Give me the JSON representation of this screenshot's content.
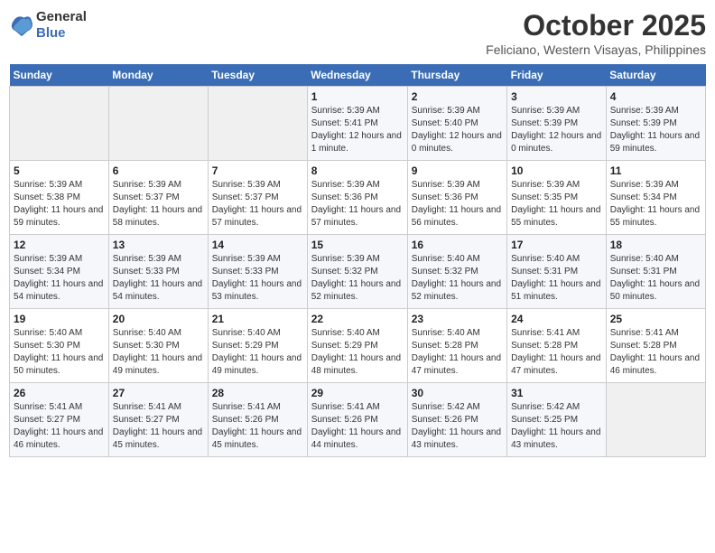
{
  "header": {
    "logo_general": "General",
    "logo_blue": "Blue",
    "month": "October 2025",
    "location": "Feliciano, Western Visayas, Philippines"
  },
  "weekdays": [
    "Sunday",
    "Monday",
    "Tuesday",
    "Wednesday",
    "Thursday",
    "Friday",
    "Saturday"
  ],
  "weeks": [
    [
      {
        "day": "",
        "empty": true
      },
      {
        "day": "",
        "empty": true
      },
      {
        "day": "",
        "empty": true
      },
      {
        "day": "1",
        "sunrise": "5:39 AM",
        "sunset": "5:41 PM",
        "daylight": "12 hours and 1 minute."
      },
      {
        "day": "2",
        "sunrise": "5:39 AM",
        "sunset": "5:40 PM",
        "daylight": "12 hours and 0 minutes."
      },
      {
        "day": "3",
        "sunrise": "5:39 AM",
        "sunset": "5:39 PM",
        "daylight": "12 hours and 0 minutes."
      },
      {
        "day": "4",
        "sunrise": "5:39 AM",
        "sunset": "5:39 PM",
        "daylight": "11 hours and 59 minutes."
      }
    ],
    [
      {
        "day": "5",
        "sunrise": "5:39 AM",
        "sunset": "5:38 PM",
        "daylight": "11 hours and 59 minutes."
      },
      {
        "day": "6",
        "sunrise": "5:39 AM",
        "sunset": "5:37 PM",
        "daylight": "11 hours and 58 minutes."
      },
      {
        "day": "7",
        "sunrise": "5:39 AM",
        "sunset": "5:37 PM",
        "daylight": "11 hours and 57 minutes."
      },
      {
        "day": "8",
        "sunrise": "5:39 AM",
        "sunset": "5:36 PM",
        "daylight": "11 hours and 57 minutes."
      },
      {
        "day": "9",
        "sunrise": "5:39 AM",
        "sunset": "5:36 PM",
        "daylight": "11 hours and 56 minutes."
      },
      {
        "day": "10",
        "sunrise": "5:39 AM",
        "sunset": "5:35 PM",
        "daylight": "11 hours and 55 minutes."
      },
      {
        "day": "11",
        "sunrise": "5:39 AM",
        "sunset": "5:34 PM",
        "daylight": "11 hours and 55 minutes."
      }
    ],
    [
      {
        "day": "12",
        "sunrise": "5:39 AM",
        "sunset": "5:34 PM",
        "daylight": "11 hours and 54 minutes."
      },
      {
        "day": "13",
        "sunrise": "5:39 AM",
        "sunset": "5:33 PM",
        "daylight": "11 hours and 54 minutes."
      },
      {
        "day": "14",
        "sunrise": "5:39 AM",
        "sunset": "5:33 PM",
        "daylight": "11 hours and 53 minutes."
      },
      {
        "day": "15",
        "sunrise": "5:39 AM",
        "sunset": "5:32 PM",
        "daylight": "11 hours and 52 minutes."
      },
      {
        "day": "16",
        "sunrise": "5:40 AM",
        "sunset": "5:32 PM",
        "daylight": "11 hours and 52 minutes."
      },
      {
        "day": "17",
        "sunrise": "5:40 AM",
        "sunset": "5:31 PM",
        "daylight": "11 hours and 51 minutes."
      },
      {
        "day": "18",
        "sunrise": "5:40 AM",
        "sunset": "5:31 PM",
        "daylight": "11 hours and 50 minutes."
      }
    ],
    [
      {
        "day": "19",
        "sunrise": "5:40 AM",
        "sunset": "5:30 PM",
        "daylight": "11 hours and 50 minutes."
      },
      {
        "day": "20",
        "sunrise": "5:40 AM",
        "sunset": "5:30 PM",
        "daylight": "11 hours and 49 minutes."
      },
      {
        "day": "21",
        "sunrise": "5:40 AM",
        "sunset": "5:29 PM",
        "daylight": "11 hours and 49 minutes."
      },
      {
        "day": "22",
        "sunrise": "5:40 AM",
        "sunset": "5:29 PM",
        "daylight": "11 hours and 48 minutes."
      },
      {
        "day": "23",
        "sunrise": "5:40 AM",
        "sunset": "5:28 PM",
        "daylight": "11 hours and 47 minutes."
      },
      {
        "day": "24",
        "sunrise": "5:41 AM",
        "sunset": "5:28 PM",
        "daylight": "11 hours and 47 minutes."
      },
      {
        "day": "25",
        "sunrise": "5:41 AM",
        "sunset": "5:28 PM",
        "daylight": "11 hours and 46 minutes."
      }
    ],
    [
      {
        "day": "26",
        "sunrise": "5:41 AM",
        "sunset": "5:27 PM",
        "daylight": "11 hours and 46 minutes."
      },
      {
        "day": "27",
        "sunrise": "5:41 AM",
        "sunset": "5:27 PM",
        "daylight": "11 hours and 45 minutes."
      },
      {
        "day": "28",
        "sunrise": "5:41 AM",
        "sunset": "5:26 PM",
        "daylight": "11 hours and 45 minutes."
      },
      {
        "day": "29",
        "sunrise": "5:41 AM",
        "sunset": "5:26 PM",
        "daylight": "11 hours and 44 minutes."
      },
      {
        "day": "30",
        "sunrise": "5:42 AM",
        "sunset": "5:26 PM",
        "daylight": "11 hours and 43 minutes."
      },
      {
        "day": "31",
        "sunrise": "5:42 AM",
        "sunset": "5:25 PM",
        "daylight": "11 hours and 43 minutes."
      },
      {
        "day": "",
        "empty": true
      }
    ]
  ]
}
